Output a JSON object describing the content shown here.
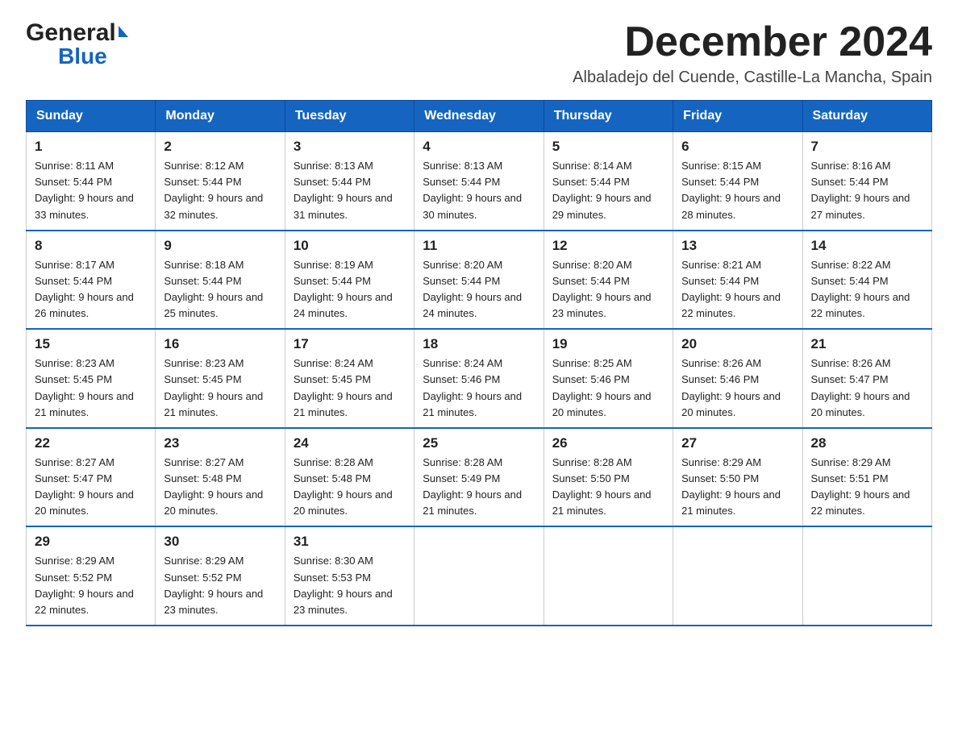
{
  "header": {
    "logo_general": "General",
    "logo_blue": "Blue",
    "title": "December 2024",
    "subtitle": "Albaladejo del Cuende, Castille-La Mancha, Spain"
  },
  "weekdays": [
    "Sunday",
    "Monday",
    "Tuesday",
    "Wednesday",
    "Thursday",
    "Friday",
    "Saturday"
  ],
  "weeks": [
    [
      {
        "day": "1",
        "sunrise": "8:11 AM",
        "sunset": "5:44 PM",
        "daylight": "9 hours and 33 minutes."
      },
      {
        "day": "2",
        "sunrise": "8:12 AM",
        "sunset": "5:44 PM",
        "daylight": "9 hours and 32 minutes."
      },
      {
        "day": "3",
        "sunrise": "8:13 AM",
        "sunset": "5:44 PM",
        "daylight": "9 hours and 31 minutes."
      },
      {
        "day": "4",
        "sunrise": "8:13 AM",
        "sunset": "5:44 PM",
        "daylight": "9 hours and 30 minutes."
      },
      {
        "day": "5",
        "sunrise": "8:14 AM",
        "sunset": "5:44 PM",
        "daylight": "9 hours and 29 minutes."
      },
      {
        "day": "6",
        "sunrise": "8:15 AM",
        "sunset": "5:44 PM",
        "daylight": "9 hours and 28 minutes."
      },
      {
        "day": "7",
        "sunrise": "8:16 AM",
        "sunset": "5:44 PM",
        "daylight": "9 hours and 27 minutes."
      }
    ],
    [
      {
        "day": "8",
        "sunrise": "8:17 AM",
        "sunset": "5:44 PM",
        "daylight": "9 hours and 26 minutes."
      },
      {
        "day": "9",
        "sunrise": "8:18 AM",
        "sunset": "5:44 PM",
        "daylight": "9 hours and 25 minutes."
      },
      {
        "day": "10",
        "sunrise": "8:19 AM",
        "sunset": "5:44 PM",
        "daylight": "9 hours and 24 minutes."
      },
      {
        "day": "11",
        "sunrise": "8:20 AM",
        "sunset": "5:44 PM",
        "daylight": "9 hours and 24 minutes."
      },
      {
        "day": "12",
        "sunrise": "8:20 AM",
        "sunset": "5:44 PM",
        "daylight": "9 hours and 23 minutes."
      },
      {
        "day": "13",
        "sunrise": "8:21 AM",
        "sunset": "5:44 PM",
        "daylight": "9 hours and 22 minutes."
      },
      {
        "day": "14",
        "sunrise": "8:22 AM",
        "sunset": "5:44 PM",
        "daylight": "9 hours and 22 minutes."
      }
    ],
    [
      {
        "day": "15",
        "sunrise": "8:23 AM",
        "sunset": "5:45 PM",
        "daylight": "9 hours and 21 minutes."
      },
      {
        "day": "16",
        "sunrise": "8:23 AM",
        "sunset": "5:45 PM",
        "daylight": "9 hours and 21 minutes."
      },
      {
        "day": "17",
        "sunrise": "8:24 AM",
        "sunset": "5:45 PM",
        "daylight": "9 hours and 21 minutes."
      },
      {
        "day": "18",
        "sunrise": "8:24 AM",
        "sunset": "5:46 PM",
        "daylight": "9 hours and 21 minutes."
      },
      {
        "day": "19",
        "sunrise": "8:25 AM",
        "sunset": "5:46 PM",
        "daylight": "9 hours and 20 minutes."
      },
      {
        "day": "20",
        "sunrise": "8:26 AM",
        "sunset": "5:46 PM",
        "daylight": "9 hours and 20 minutes."
      },
      {
        "day": "21",
        "sunrise": "8:26 AM",
        "sunset": "5:47 PM",
        "daylight": "9 hours and 20 minutes."
      }
    ],
    [
      {
        "day": "22",
        "sunrise": "8:27 AM",
        "sunset": "5:47 PM",
        "daylight": "9 hours and 20 minutes."
      },
      {
        "day": "23",
        "sunrise": "8:27 AM",
        "sunset": "5:48 PM",
        "daylight": "9 hours and 20 minutes."
      },
      {
        "day": "24",
        "sunrise": "8:28 AM",
        "sunset": "5:48 PM",
        "daylight": "9 hours and 20 minutes."
      },
      {
        "day": "25",
        "sunrise": "8:28 AM",
        "sunset": "5:49 PM",
        "daylight": "9 hours and 21 minutes."
      },
      {
        "day": "26",
        "sunrise": "8:28 AM",
        "sunset": "5:50 PM",
        "daylight": "9 hours and 21 minutes."
      },
      {
        "day": "27",
        "sunrise": "8:29 AM",
        "sunset": "5:50 PM",
        "daylight": "9 hours and 21 minutes."
      },
      {
        "day": "28",
        "sunrise": "8:29 AM",
        "sunset": "5:51 PM",
        "daylight": "9 hours and 22 minutes."
      }
    ],
    [
      {
        "day": "29",
        "sunrise": "8:29 AM",
        "sunset": "5:52 PM",
        "daylight": "9 hours and 22 minutes."
      },
      {
        "day": "30",
        "sunrise": "8:29 AM",
        "sunset": "5:52 PM",
        "daylight": "9 hours and 23 minutes."
      },
      {
        "day": "31",
        "sunrise": "8:30 AM",
        "sunset": "5:53 PM",
        "daylight": "9 hours and 23 minutes."
      },
      null,
      null,
      null,
      null
    ]
  ]
}
